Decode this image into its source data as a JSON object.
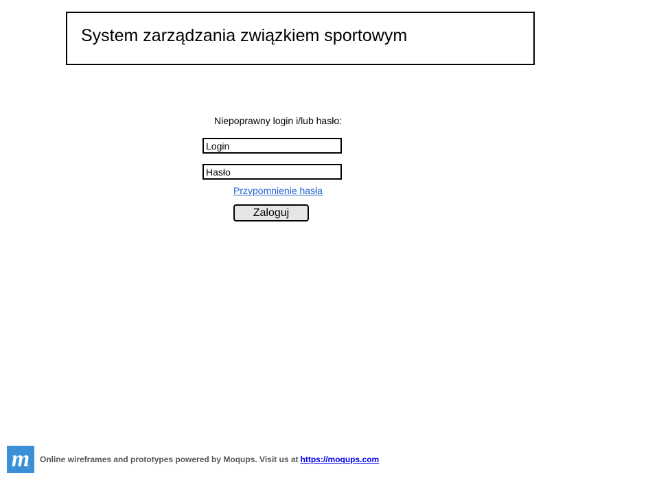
{
  "header": {
    "title": "System zarządzania związkiem sportowym"
  },
  "login_form": {
    "error_message": "Niepoprawny login i/lub hasło:",
    "login_placeholder": "Login",
    "password_placeholder": "Hasło",
    "reset_link_label": "Przypomnienie hasła",
    "submit_label": "Zaloguj"
  },
  "footer": {
    "logo_letter": "m",
    "logo_icon": "moqups-logo-icon",
    "text": "Online wireframes and prototypes powered by Moqups. Visit us at",
    "link_label": "https://moqups.com"
  },
  "colors": {
    "link": "#1f5fd1",
    "logo_bg": "#3a8fd6",
    "button_bg": "#e6e6e6"
  }
}
